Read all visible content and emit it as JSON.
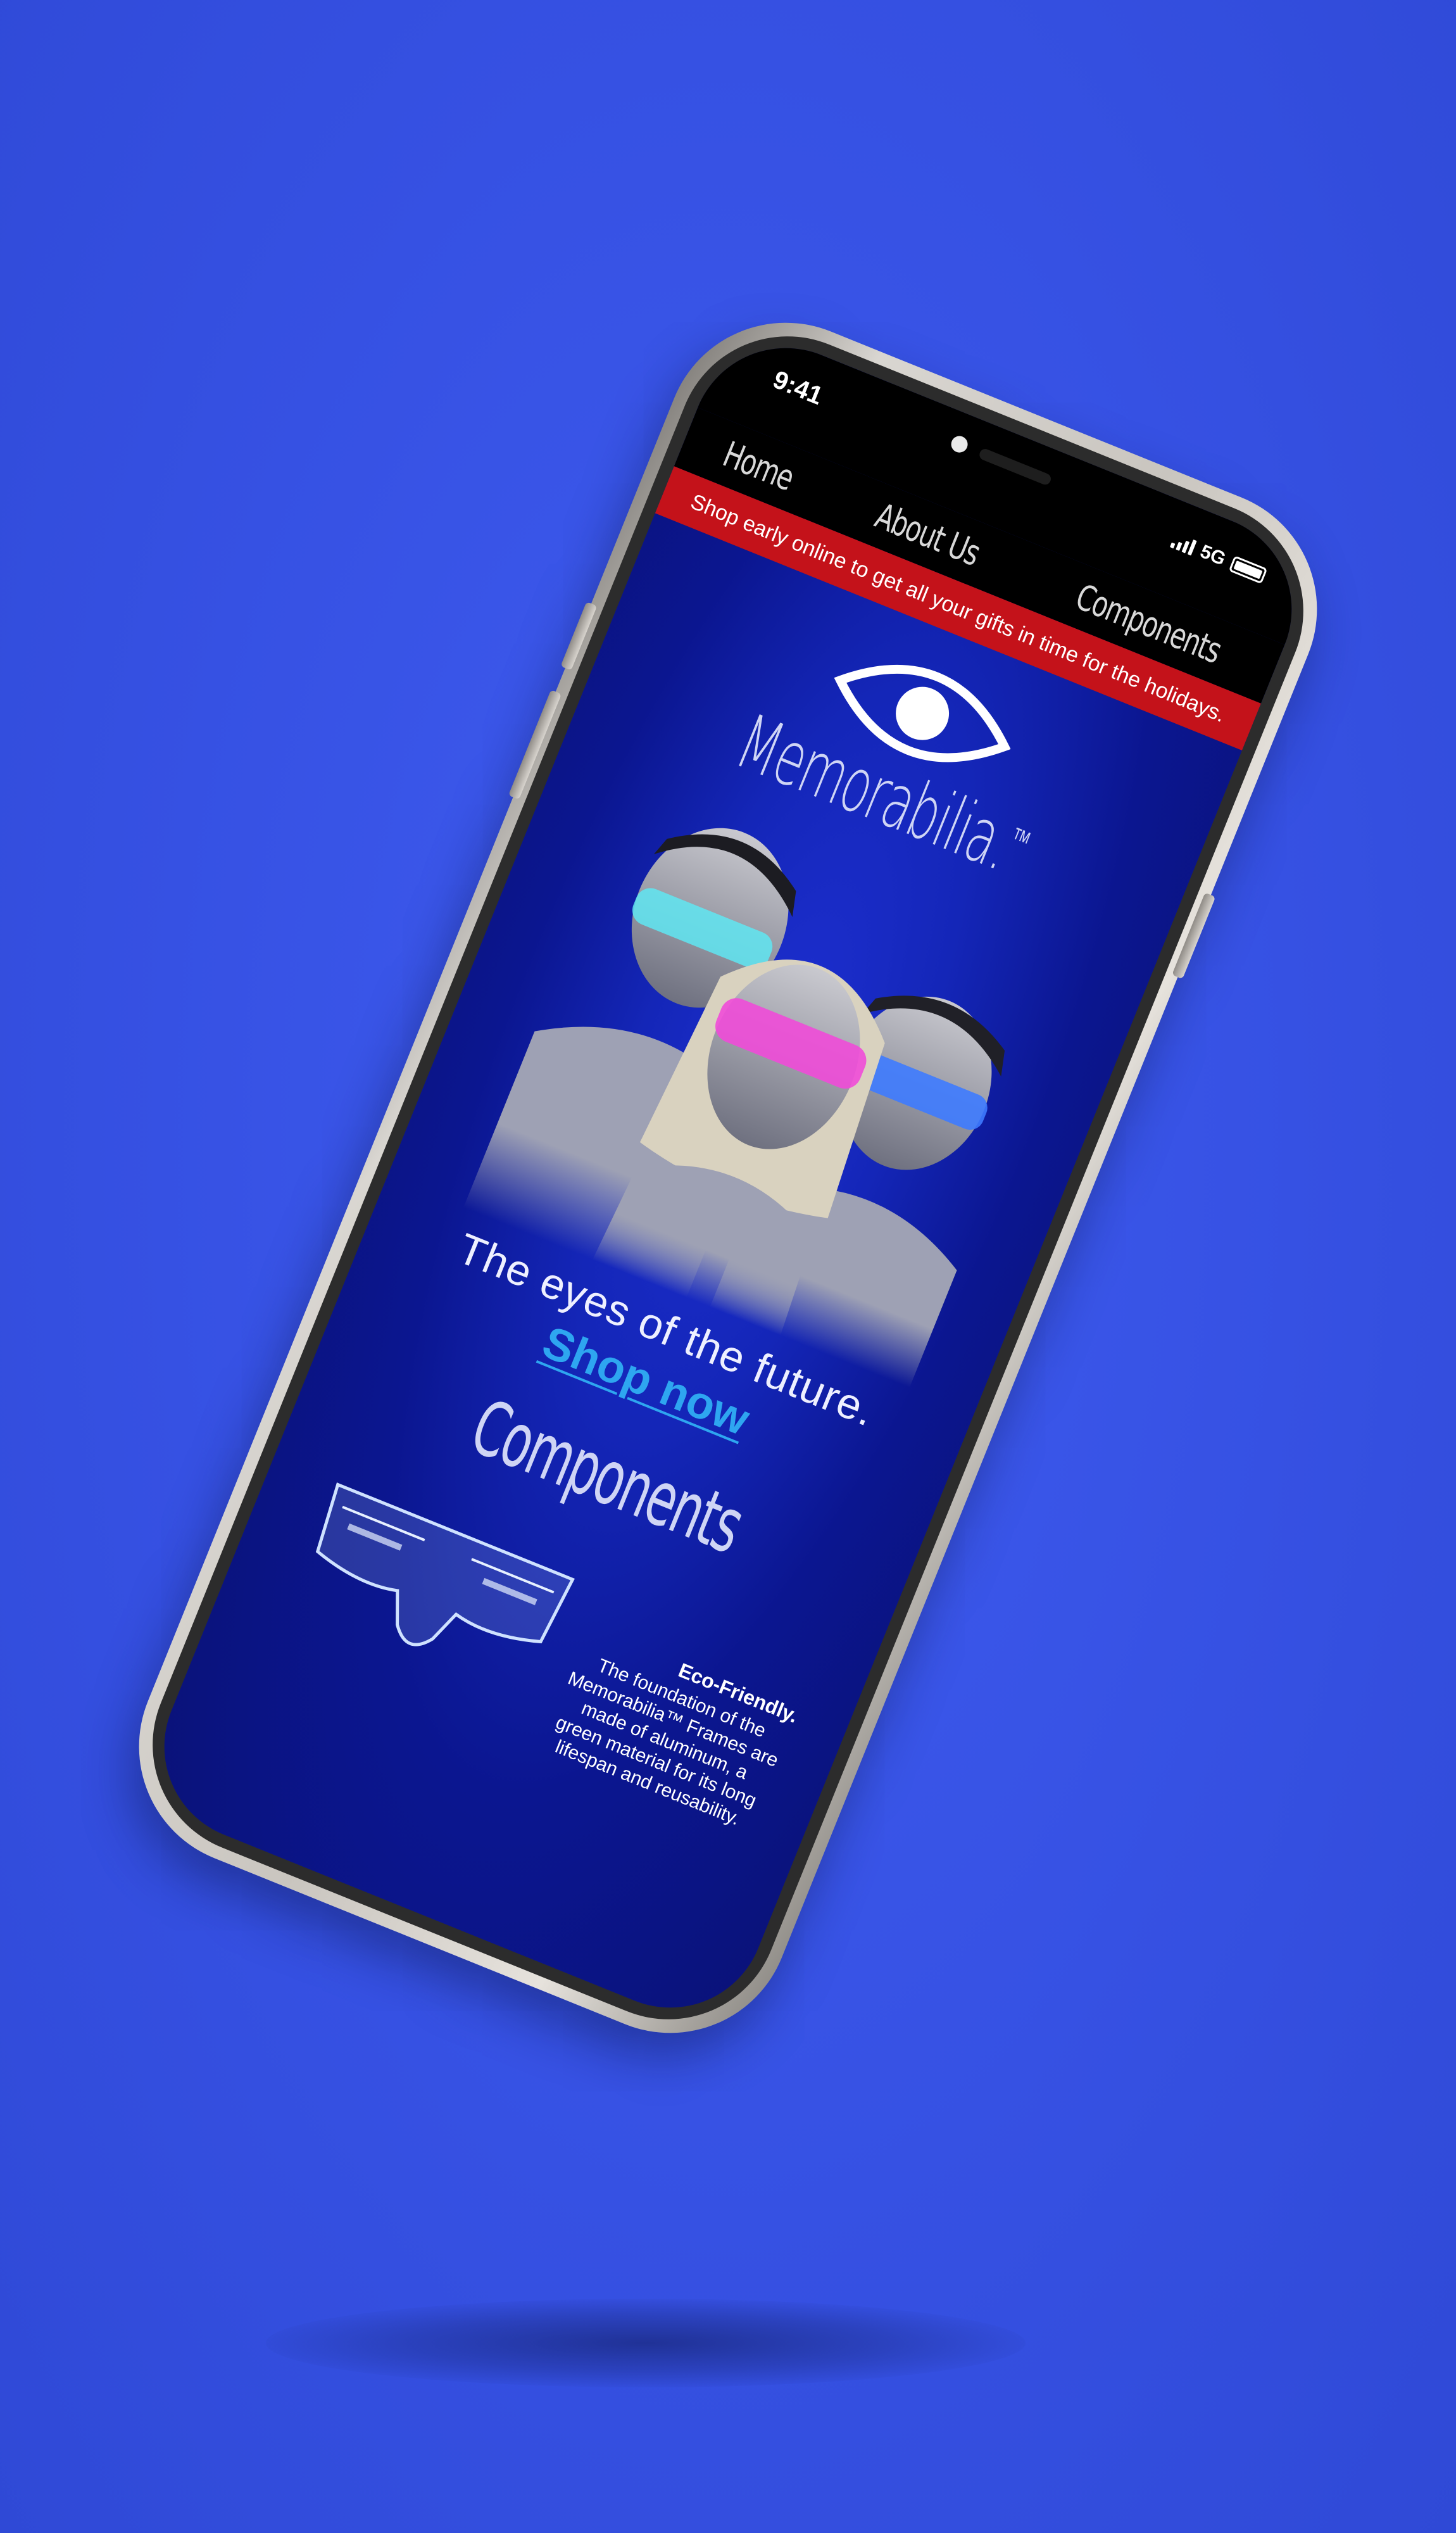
{
  "status_bar": {
    "time": "9:41",
    "network": "5G"
  },
  "nav": {
    "items": [
      {
        "label": "Home"
      },
      {
        "label": "About Us"
      },
      {
        "label": "Components"
      }
    ]
  },
  "promo_banner": {
    "text": "Shop early online to get all your gifts in time for the holidays.",
    "color": "#c4121a"
  },
  "hero": {
    "brand": "Memorabilia.",
    "brand_mark": "™",
    "tagline": "The eyes of the future.",
    "cta_label": "Shop now",
    "cta_color": "#2ea6f0"
  },
  "components": {
    "heading": "Components",
    "feature_title": "Eco-Friendly.",
    "feature_body": "The foundation of the Memorabilia™ Frames are made of aluminum, a green material for its long lifespan and reusability."
  },
  "colors": {
    "background": "#3a55e4",
    "screen": "#0b1690",
    "glasses_cyan": "#5fe6f2",
    "glasses_pink": "#f04bd8",
    "glasses_blue": "#3e7bff"
  },
  "icons": {
    "logo": "eye-icon",
    "signal": "signal-bars-icon",
    "battery": "battery-icon"
  }
}
